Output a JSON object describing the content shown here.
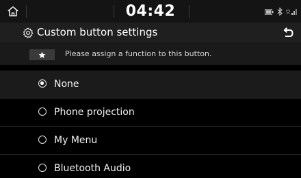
{
  "status_bar": {
    "time": "04:42",
    "icons": [
      "home-icon",
      "battery-icon",
      "bluetooth-icon",
      "signal-icon"
    ]
  },
  "header": {
    "title": "Custom button settings",
    "icons": [
      "gear-icon",
      "back-arrow-icon"
    ]
  },
  "hint": {
    "icon": "star-icon",
    "text": "Please assign a function to this button."
  },
  "options": [
    {
      "label": "None",
      "selected": true
    },
    {
      "label": "Phone projection",
      "selected": false
    },
    {
      "label": "My Menu",
      "selected": false
    },
    {
      "label": "Bluetooth Audio",
      "selected": false
    }
  ],
  "colors": {
    "background": "#000000",
    "statusbar": "#141414",
    "titlebar": "#1f1f1f",
    "selected_row": "#1b1b1b",
    "text": "#ffffff"
  }
}
